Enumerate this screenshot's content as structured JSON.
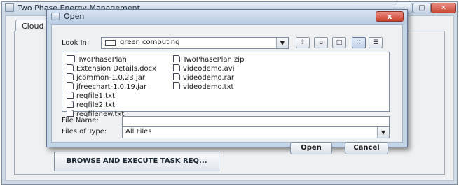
{
  "main_window": {
    "title": "Two Phase Energy Management",
    "tab_label": "Cloud",
    "browse_button": "BROWSE AND EXECUTE TASK REQ...",
    "min_glyph": "–",
    "max_glyph": "□",
    "close_glyph": "✕"
  },
  "dialog": {
    "title": "Open",
    "close_glyph": "x",
    "look_in_label": "Look In:",
    "look_in_value": "green computing",
    "combo_arrow": "▼",
    "toolbar": {
      "up_glyph": "⇧",
      "home_glyph": "⌂",
      "newfolder_glyph": "□",
      "list_glyph": "∷",
      "details_glyph": "☰"
    },
    "files": [
      {
        "name": "TwoPhasePlan",
        "icon": "folder-icon"
      },
      {
        "name": "Extension Details.docx",
        "icon": "file-icon"
      },
      {
        "name": "jcommon-1.0.23.jar",
        "icon": "file-icon"
      },
      {
        "name": "jfreechart-1.0.19.jar",
        "icon": "file-icon"
      },
      {
        "name": "reqfile1.txt",
        "icon": "file-icon"
      },
      {
        "name": "reqfile2.txt",
        "icon": "file-icon"
      },
      {
        "name": "reqfilenew.txt",
        "icon": "file-icon"
      },
      {
        "name": "TwoPhasePlan.zip",
        "icon": "file-icon"
      },
      {
        "name": "videodemo.avi",
        "icon": "file-icon"
      },
      {
        "name": "videodemo.rar",
        "icon": "file-icon"
      },
      {
        "name": "videodemo.txt",
        "icon": "file-icon"
      }
    ],
    "file_name_label": "File Name:",
    "file_name_value": "",
    "files_of_type_label": "Files of Type:",
    "files_of_type_value": "All Files",
    "open_button": "Open",
    "cancel_button": "Cancel"
  }
}
